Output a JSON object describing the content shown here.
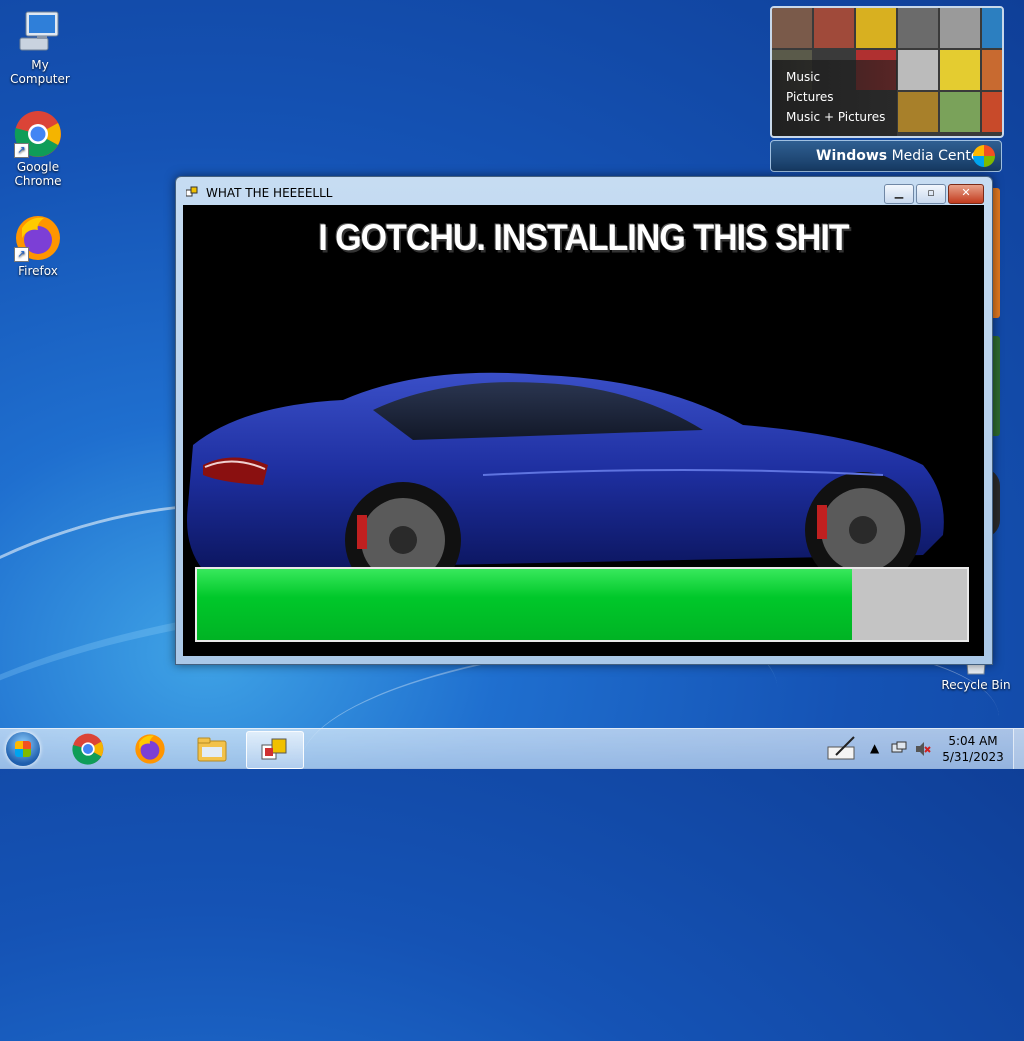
{
  "desktop": {
    "icons": [
      {
        "label": "My Computer",
        "icon": "computer-icon"
      },
      {
        "label": "Google Chrome",
        "icon": "chrome-icon"
      },
      {
        "label": "Firefox",
        "icon": "firefox-icon"
      },
      {
        "label": "Recycle Bin",
        "icon": "recycle-bin-icon"
      }
    ]
  },
  "media_center": {
    "menu": [
      "Music",
      "Pictures",
      "Music + Pictures"
    ],
    "brand_bold": "Windows",
    "brand_light": "Media Center"
  },
  "window": {
    "title": "WHAT THE HEEEELLL",
    "headline": "I GOTCHU. INSTALLING THIS SHIT",
    "progress_fraction": 0.85,
    "progress_color": "#00c82a"
  },
  "taskbar": {
    "pinned": [
      "chrome-icon",
      "firefox-icon",
      "explorer-icon",
      "app-icon"
    ],
    "clock_time": "5:04 AM",
    "clock_date": "5/31/2023"
  }
}
